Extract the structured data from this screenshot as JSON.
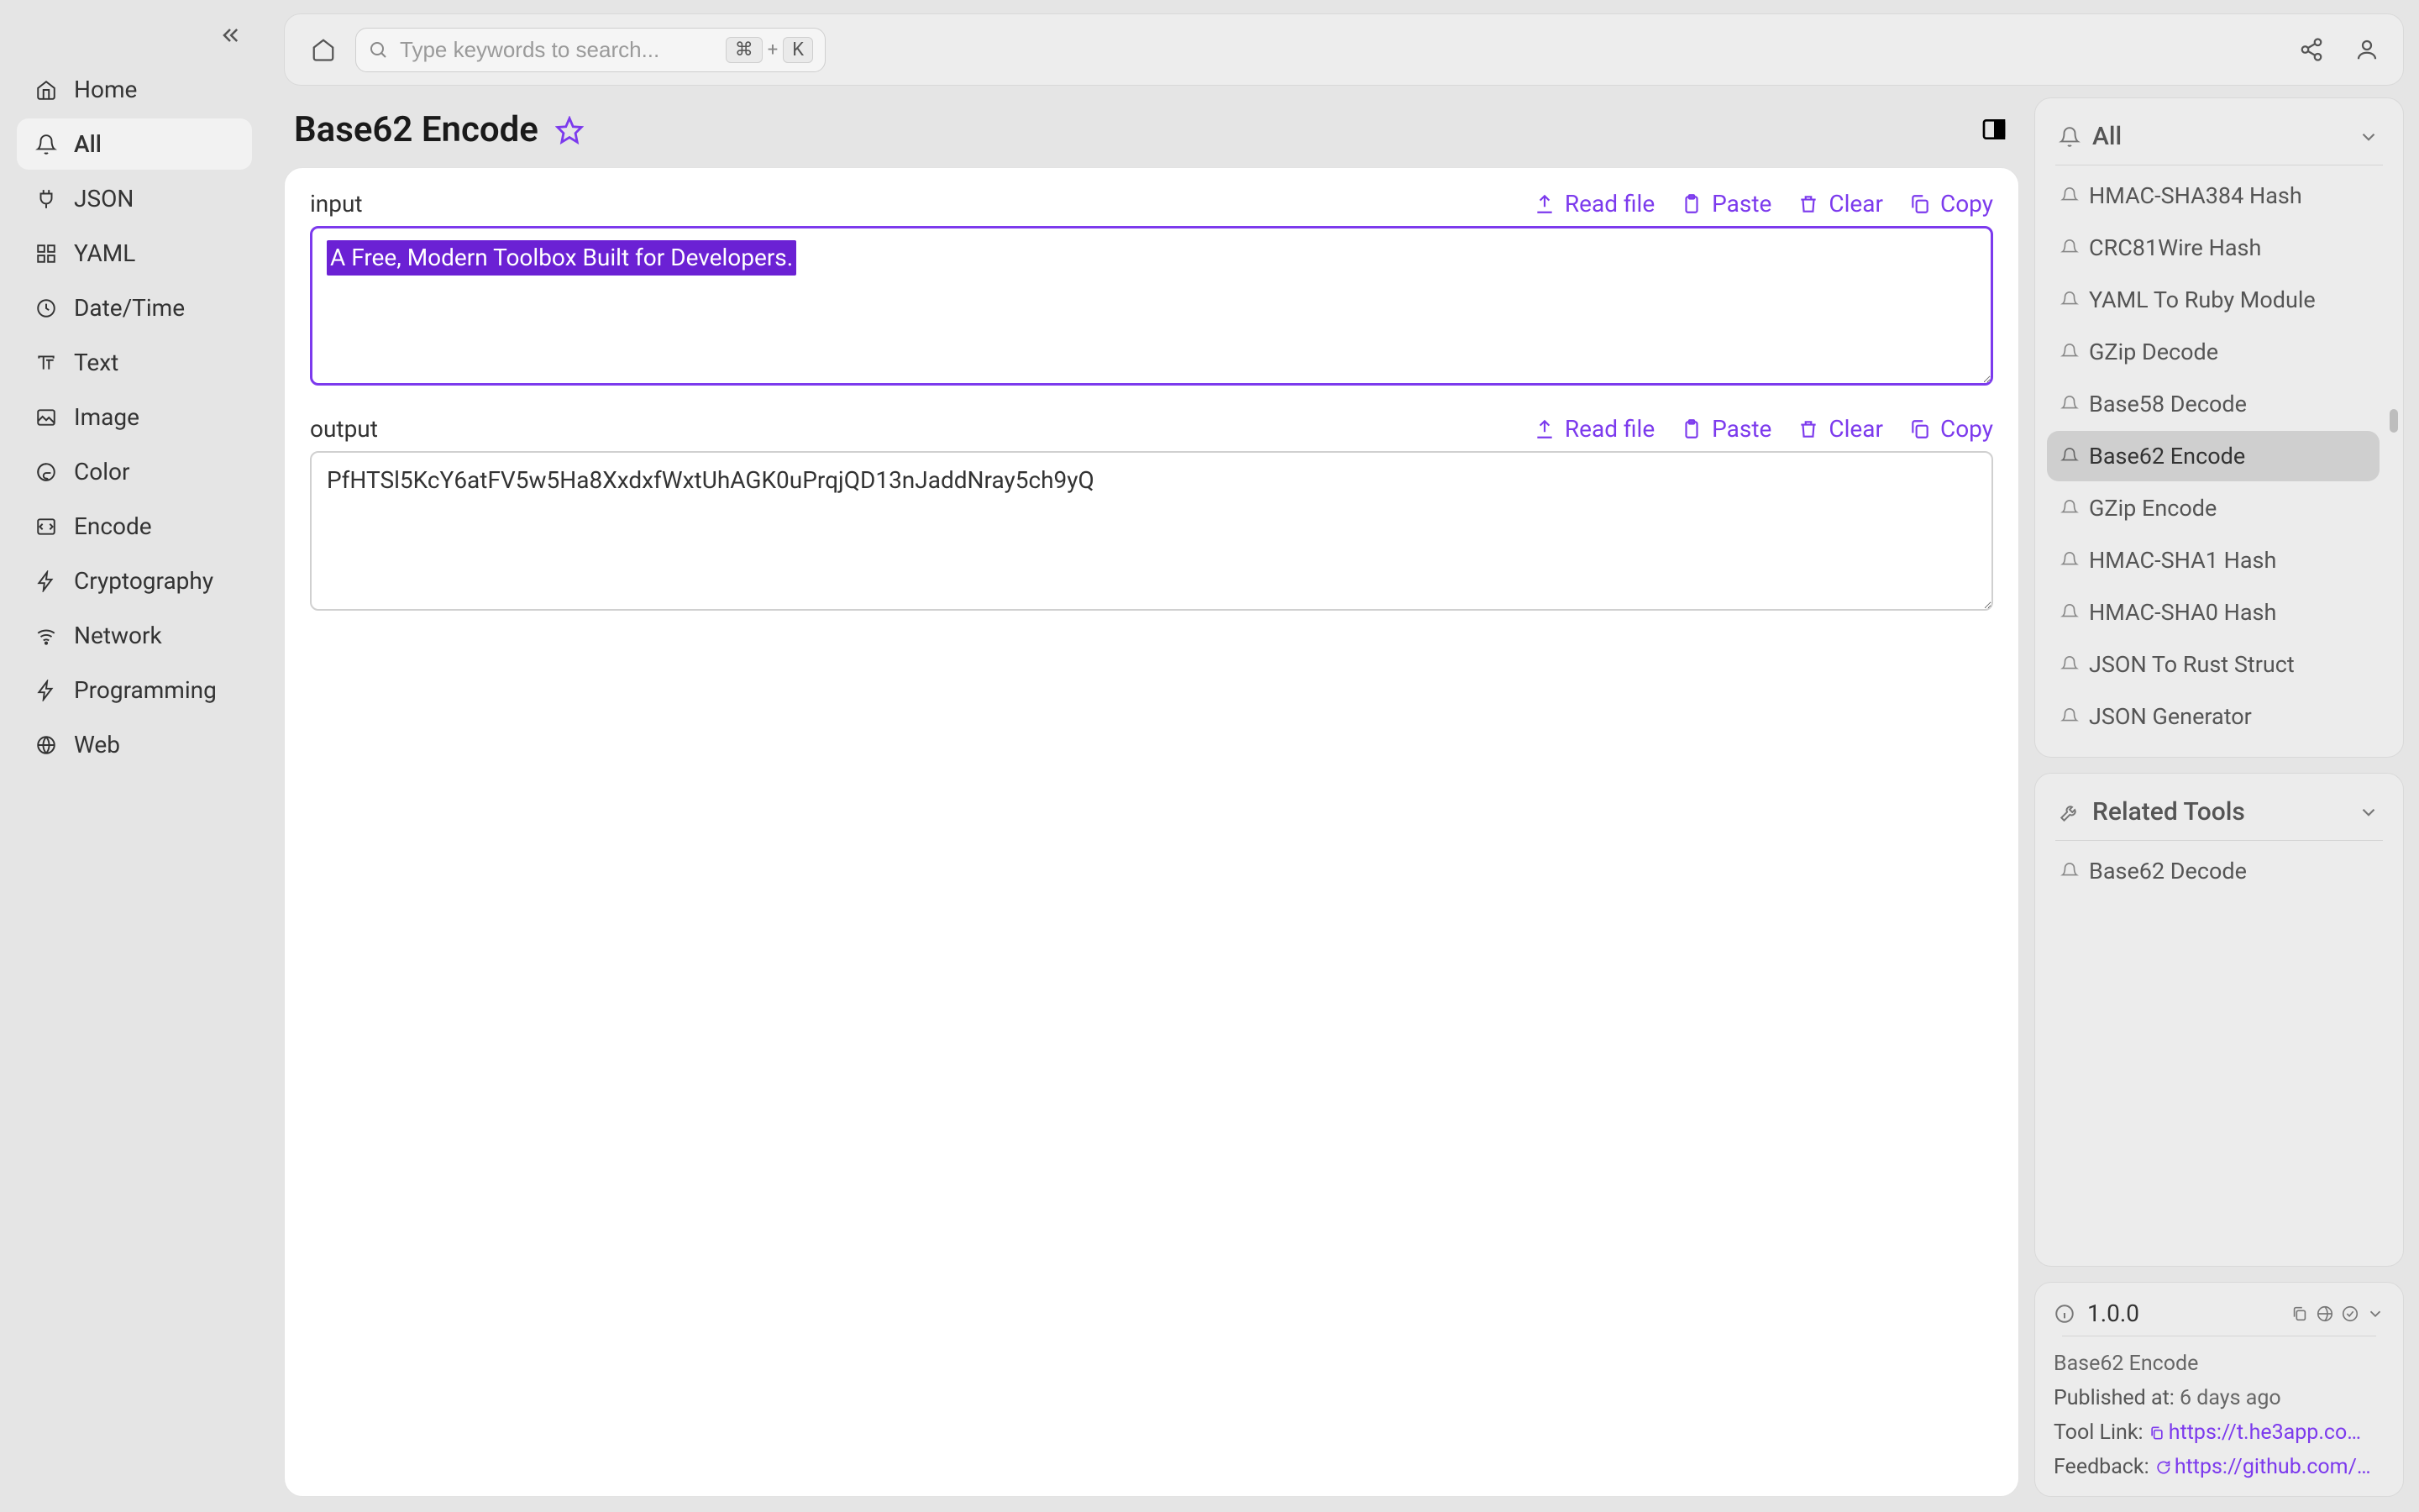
{
  "search": {
    "placeholder": "Type keywords to search...",
    "kbd1": "⌘",
    "kbd_plus": "+",
    "kbd2": "K"
  },
  "sidebar": {
    "items": [
      {
        "label": "Home"
      },
      {
        "label": "All"
      },
      {
        "label": "JSON"
      },
      {
        "label": "YAML"
      },
      {
        "label": "Date/Time"
      },
      {
        "label": "Text"
      },
      {
        "label": "Image"
      },
      {
        "label": "Color"
      },
      {
        "label": "Encode"
      },
      {
        "label": "Cryptography"
      },
      {
        "label": "Network"
      },
      {
        "label": "Programming"
      },
      {
        "label": "Web"
      }
    ]
  },
  "page": {
    "title": "Base62 Encode"
  },
  "fields": {
    "input_label": "input",
    "output_label": "output",
    "actions": {
      "read_file": "Read file",
      "paste": "Paste",
      "clear": "Clear",
      "copy": "Copy"
    },
    "input_value": "A Free, Modern Toolbox Built for Developers.",
    "output_value": "PfHTSl5KcY6atFV5w5Ha8XxdxfWxtUhAGK0uPrqjQD13nJaddNray5ch9yQ"
  },
  "right": {
    "all_title": "All",
    "all_items": [
      "HMAC-SHA384 Hash",
      "CRC81Wire Hash",
      "YAML To Ruby Module",
      "GZip Decode",
      "Base58 Decode",
      "Base62 Encode",
      "GZip Encode",
      "HMAC-SHA1 Hash",
      "HMAC-SHA0 Hash",
      "JSON To Rust Struct",
      "JSON Generator"
    ],
    "related_title": "Related Tools",
    "related_items": [
      "Base62 Decode"
    ],
    "info": {
      "version": "1.0.0",
      "name": "Base62 Encode",
      "published_label": "Published at:",
      "published_value": "6 days ago",
      "toollink_label": "Tool Link:",
      "toollink_value": "https://t.he3app.co…",
      "feedback_label": "Feedback:",
      "feedback_value": "https://github.com/…"
    }
  }
}
